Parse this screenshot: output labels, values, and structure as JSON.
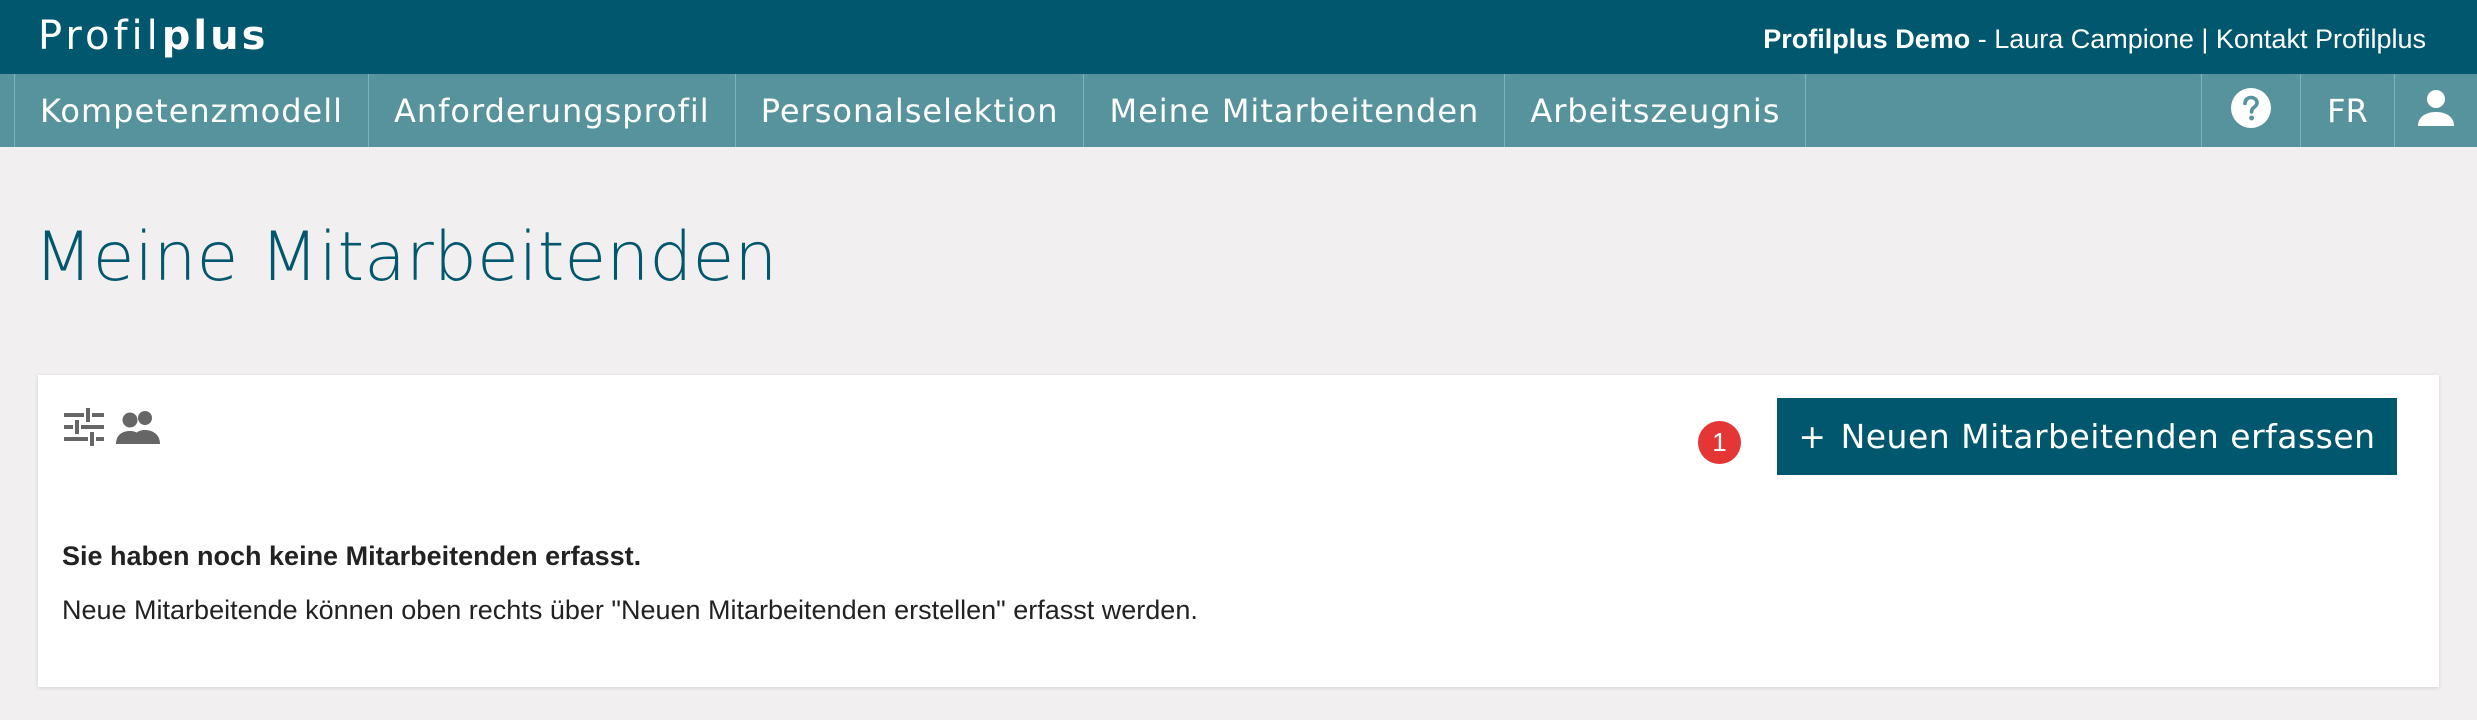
{
  "header": {
    "logo_light": "Profil",
    "logo_bold": "plus",
    "company": "Profilplus Demo",
    "separator_1": " - ",
    "user_name": "Laura Campione",
    "separator_2": " | ",
    "contact_link": "Kontakt Profilplus"
  },
  "nav": {
    "items": [
      {
        "label": "Kompetenzmodell"
      },
      {
        "label": "Anforderungsprofil"
      },
      {
        "label": "Personalselektion"
      },
      {
        "label": "Meine Mitarbeitenden"
      },
      {
        "label": "Arbeitszeugnis"
      }
    ],
    "language": "FR",
    "help_icon": "help-circle-icon",
    "user_icon": "person-icon"
  },
  "page": {
    "title": "Meine Mitarbeitenden"
  },
  "card": {
    "filter_icon": "tune-sliders-icon",
    "people_icon": "people-icon",
    "badge_count": "1",
    "add_button_plus": "+",
    "add_button_label": "Neuen Mitarbeitenden erfassen",
    "empty_title": "Sie haben noch keine Mitarbeitenden erfasst.",
    "empty_hint": "Neue Mitarbeitende können oben rechts über \"Neuen Mitarbeitenden erstellen\" erfasst werden."
  },
  "colors": {
    "primary": "#01576d",
    "nav": "#57939c",
    "background": "#f1eff0",
    "badge": "#e53636",
    "icon_gray": "#666666"
  }
}
